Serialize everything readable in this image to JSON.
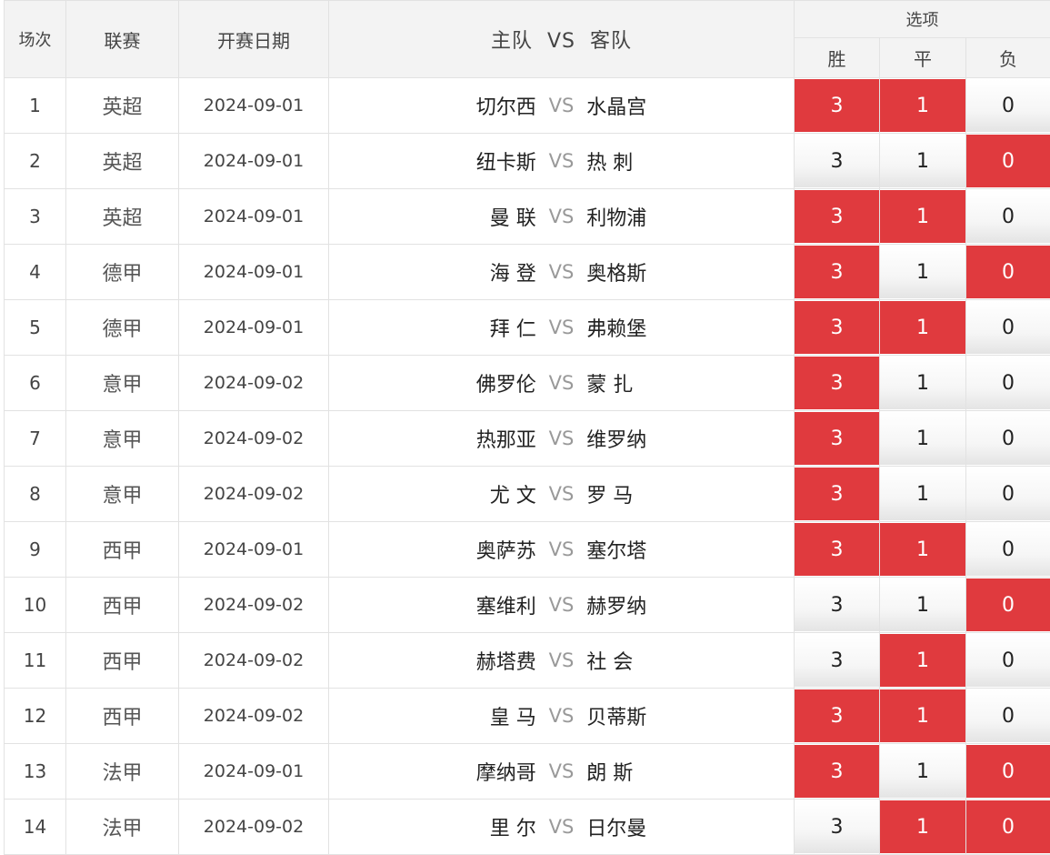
{
  "header": {
    "col_index": "场次",
    "col_league": "联赛",
    "col_date": "开赛日期",
    "col_home": "主队",
    "col_vs": "VS",
    "col_away": "客队",
    "col_options": "选项",
    "opt_win": "胜",
    "opt_draw": "平",
    "opt_lose": "负"
  },
  "vs_label": "VS",
  "rows": [
    {
      "no": "1",
      "league": "英超",
      "date": "2024-09-01",
      "home": "切尔西",
      "away": "水晶宫",
      "win": "3",
      "draw": "1",
      "lose": "0",
      "sel": [
        true,
        true,
        false
      ]
    },
    {
      "no": "2",
      "league": "英超",
      "date": "2024-09-01",
      "home": "纽卡斯",
      "away": "热 刺",
      "win": "3",
      "draw": "1",
      "lose": "0",
      "sel": [
        false,
        false,
        true
      ]
    },
    {
      "no": "3",
      "league": "英超",
      "date": "2024-09-01",
      "home": "曼 联",
      "away": "利物浦",
      "win": "3",
      "draw": "1",
      "lose": "0",
      "sel": [
        true,
        true,
        false
      ]
    },
    {
      "no": "4",
      "league": "德甲",
      "date": "2024-09-01",
      "home": "海 登",
      "away": "奥格斯",
      "win": "3",
      "draw": "1",
      "lose": "0",
      "sel": [
        true,
        false,
        true
      ]
    },
    {
      "no": "5",
      "league": "德甲",
      "date": "2024-09-01",
      "home": "拜 仁",
      "away": "弗赖堡",
      "win": "3",
      "draw": "1",
      "lose": "0",
      "sel": [
        true,
        true,
        false
      ]
    },
    {
      "no": "6",
      "league": "意甲",
      "date": "2024-09-02",
      "home": "佛罗伦",
      "away": "蒙 扎",
      "win": "3",
      "draw": "1",
      "lose": "0",
      "sel": [
        true,
        false,
        false
      ]
    },
    {
      "no": "7",
      "league": "意甲",
      "date": "2024-09-02",
      "home": "热那亚",
      "away": "维罗纳",
      "win": "3",
      "draw": "1",
      "lose": "0",
      "sel": [
        true,
        false,
        false
      ]
    },
    {
      "no": "8",
      "league": "意甲",
      "date": "2024-09-02",
      "home": "尤 文",
      "away": "罗 马",
      "win": "3",
      "draw": "1",
      "lose": "0",
      "sel": [
        true,
        false,
        false
      ]
    },
    {
      "no": "9",
      "league": "西甲",
      "date": "2024-09-01",
      "home": "奥萨苏",
      "away": "塞尔塔",
      "win": "3",
      "draw": "1",
      "lose": "0",
      "sel": [
        true,
        true,
        false
      ]
    },
    {
      "no": "10",
      "league": "西甲",
      "date": "2024-09-02",
      "home": "塞维利",
      "away": "赫罗纳",
      "win": "3",
      "draw": "1",
      "lose": "0",
      "sel": [
        false,
        false,
        true
      ]
    },
    {
      "no": "11",
      "league": "西甲",
      "date": "2024-09-02",
      "home": "赫塔费",
      "away": "社 会",
      "win": "3",
      "draw": "1",
      "lose": "0",
      "sel": [
        false,
        true,
        false
      ]
    },
    {
      "no": "12",
      "league": "西甲",
      "date": "2024-09-02",
      "home": "皇 马",
      "away": "贝蒂斯",
      "win": "3",
      "draw": "1",
      "lose": "0",
      "sel": [
        true,
        true,
        false
      ]
    },
    {
      "no": "13",
      "league": "法甲",
      "date": "2024-09-01",
      "home": "摩纳哥",
      "away": "朗 斯",
      "win": "3",
      "draw": "1",
      "lose": "0",
      "sel": [
        true,
        false,
        true
      ]
    },
    {
      "no": "14",
      "league": "法甲",
      "date": "2024-09-02",
      "home": "里 尔",
      "away": "日尔曼",
      "win": "3",
      "draw": "1",
      "lose": "0",
      "sel": [
        false,
        true,
        true
      ]
    }
  ],
  "colors": {
    "selected_bg": "#e03a3e",
    "selected_fg": "#ffffff",
    "header_bg": "#f3f3f3",
    "border": "#e2e2e2"
  }
}
